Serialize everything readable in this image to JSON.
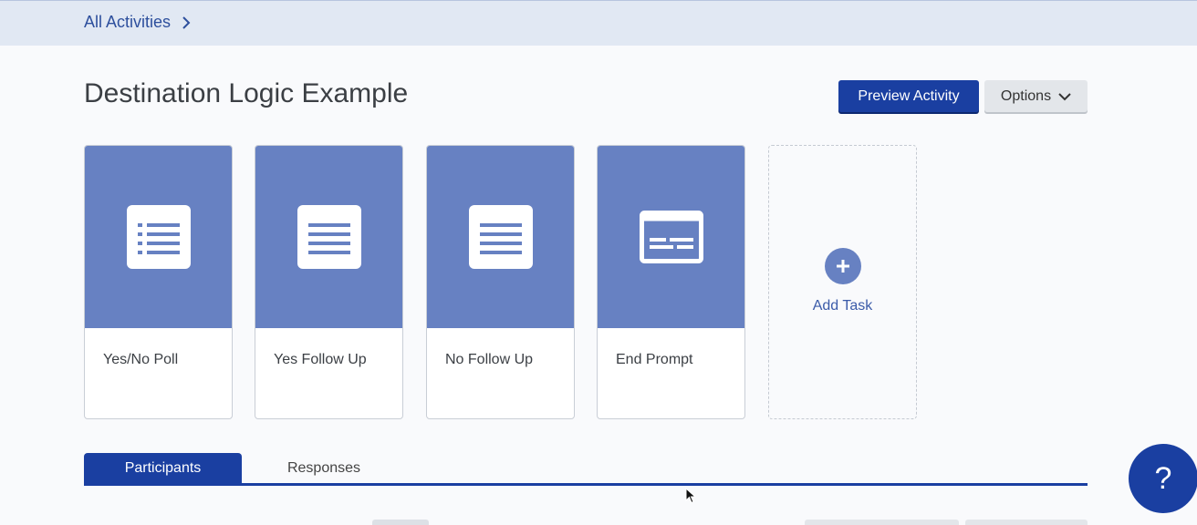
{
  "breadcrumb": {
    "label": "All Activities"
  },
  "page": {
    "title": "Destination Logic Example"
  },
  "actions": {
    "preview_label": "Preview Activity",
    "options_label": "Options"
  },
  "tasks": [
    {
      "label": "Yes/No Poll",
      "icon": "list-icon"
    },
    {
      "label": "Yes Follow Up",
      "icon": "text-lines-icon"
    },
    {
      "label": "No Follow Up",
      "icon": "text-lines-icon"
    },
    {
      "label": "End Prompt",
      "icon": "prompt-icon"
    }
  ],
  "add_task": {
    "label": "Add Task"
  },
  "tabs": [
    {
      "label": "Participants",
      "active": true
    },
    {
      "label": "Responses",
      "active": false
    }
  ],
  "help": {
    "label": "?"
  },
  "colors": {
    "primary": "#1a3fa1",
    "card_header": "#6781c2",
    "top_bar": "#e1e8f3"
  }
}
